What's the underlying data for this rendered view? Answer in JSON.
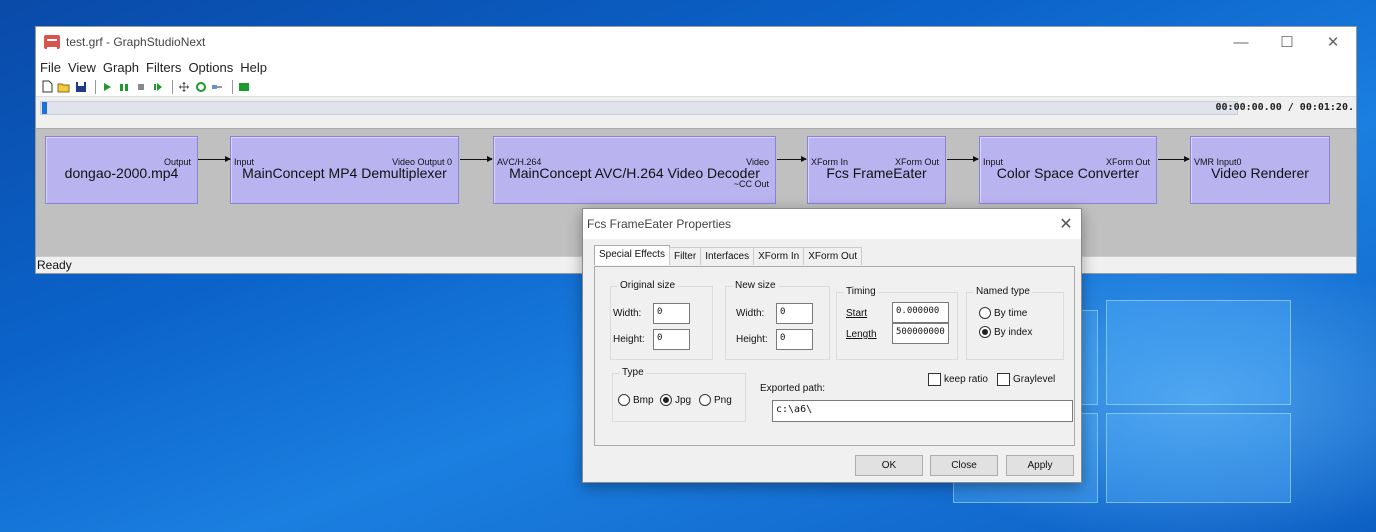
{
  "window": {
    "title": "test.grf - GraphStudioNext",
    "controls": {
      "minimize": "—",
      "maximize": "☐",
      "close": "✕"
    }
  },
  "menu": [
    "File",
    "View",
    "Graph",
    "Filters",
    "Options",
    "Help"
  ],
  "toolbar": {
    "icons": [
      "new-icon",
      "open-icon",
      "save-icon",
      "play-icon",
      "pause-icon",
      "stop-icon",
      "step-icon",
      "arrange-icon",
      "refresh-icon",
      "connect-icon",
      "filters-icon"
    ]
  },
  "seek": {
    "position_fraction": 0.0,
    "time": "00:00:00.00 / 00:01:20."
  },
  "graph": {
    "filters": [
      {
        "name": "dongao-2000.mp4",
        "in_pin": "",
        "out_pin": "Output",
        "out_pin2": ""
      },
      {
        "name": "MainConcept MP4 Demultiplexer",
        "in_pin": "Input",
        "out_pin": "Video Output 0",
        "out_pin2": ""
      },
      {
        "name": "MainConcept AVC/H.264 Video Decoder",
        "in_pin": "AVC/H.264",
        "out_pin": "Video",
        "out_pin2": "~CC Out"
      },
      {
        "name": "Fcs FrameEater",
        "in_pin": "XForm In",
        "out_pin": "XForm Out",
        "out_pin2": ""
      },
      {
        "name": "Color Space Converter",
        "in_pin": "Input",
        "out_pin": "XForm Out",
        "out_pin2": ""
      },
      {
        "name": "Video Renderer",
        "in_pin": "VMR Input0",
        "out_pin": "",
        "out_pin2": ""
      }
    ]
  },
  "status": {
    "text": "Ready"
  },
  "dialog": {
    "title": "Fcs FrameEater Properties",
    "close": "✕",
    "tabs": [
      "Special Effects",
      "Filter",
      "Interfaces",
      "XForm In",
      "XForm Out"
    ],
    "active_tab": "Special Effects",
    "original_size": {
      "label": "Original size",
      "width_label": "Width:",
      "width": "0",
      "height_label": "Height:",
      "height": "0"
    },
    "new_size": {
      "label": "New size",
      "width_label": "Width:",
      "width": "0",
      "height_label": "Height:",
      "height": "0"
    },
    "timing": {
      "label": "Timing",
      "start_label": "Start",
      "start": "0.000000",
      "length_label": "Length",
      "length": "500000000"
    },
    "named_type": {
      "label": "Named type",
      "options": [
        "By time",
        "By index"
      ],
      "selected": "By index"
    },
    "type": {
      "label": "Type",
      "options": [
        "Bmp",
        "Jpg",
        "Png"
      ],
      "selected": "Jpg"
    },
    "keep_ratio": {
      "label": "keep ratio",
      "checked": false
    },
    "graylevel": {
      "label": "Graylevel",
      "checked": false
    },
    "exported_path": {
      "label": "Exported path:",
      "value": "c:\\a6\\"
    },
    "buttons": {
      "ok": "OK",
      "close": "Close",
      "apply": "Apply"
    }
  }
}
